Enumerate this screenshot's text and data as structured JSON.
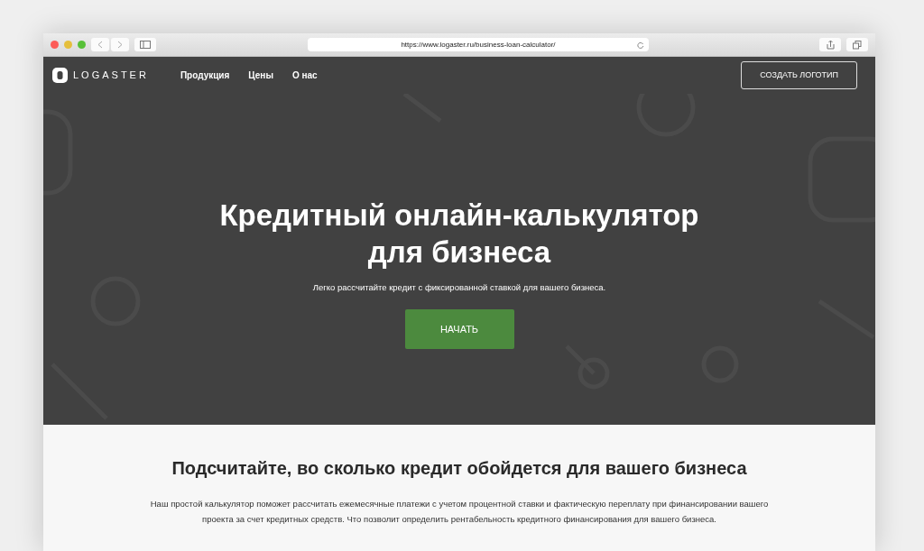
{
  "browser": {
    "url": "https://www.logaster.ru/business-loan-calculator/"
  },
  "navbar": {
    "logo": "LOGASTER",
    "items": [
      {
        "label": "Продукция"
      },
      {
        "label": "Цены"
      },
      {
        "label": "О нас"
      }
    ],
    "cta": "СОЗДАТЬ ЛОГОТИП"
  },
  "hero": {
    "title": "Кредитный онлайн-калькулятор для бизнеса",
    "subtitle": "Легко рассчитайте кредит с фиксированной ставкой для вашего бизнеса.",
    "button": "НАЧАТЬ"
  },
  "section": {
    "heading": "Подсчитайте, во сколько кредит обойдется для вашего бизнеса",
    "text": "Наш простой калькулятор поможет рассчитать ежемесячные платежи с учетом процентной ставки и фактическую переплату при финансировании вашего проекта за счет кредитных средств. Что позволит определить рентабельность кредитного финансирования для вашего бизнеса."
  }
}
